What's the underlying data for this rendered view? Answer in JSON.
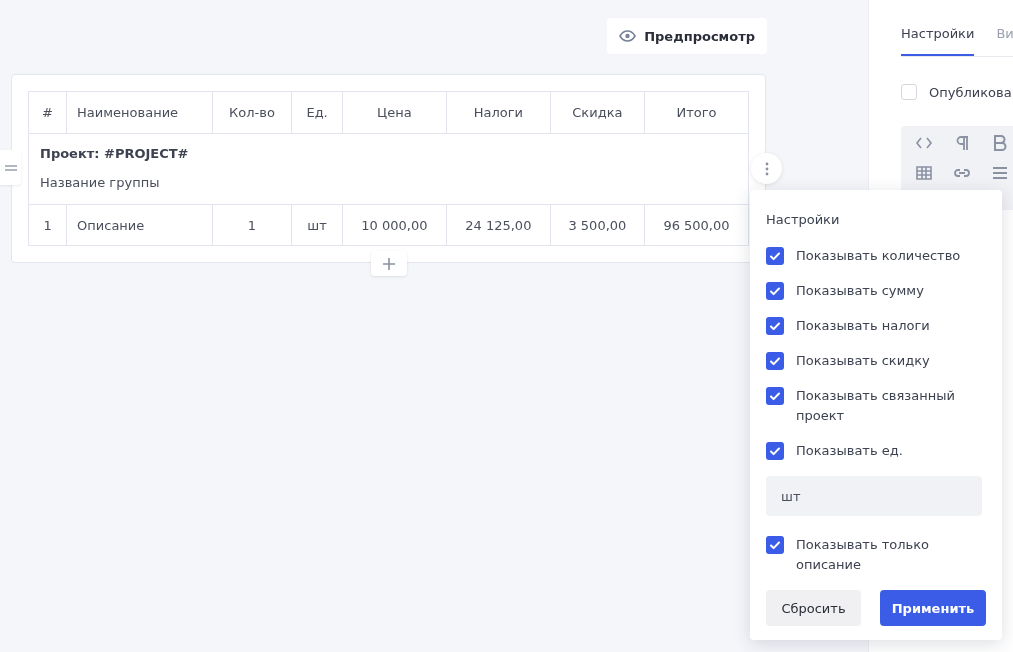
{
  "preview_button": {
    "label": "Предпросмотр"
  },
  "table": {
    "columns": [
      "#",
      "Наименование",
      "Кол-во",
      "Ед.",
      "Цена",
      "Налоги",
      "Скидка",
      "Итого"
    ],
    "group": {
      "project": "Проект: #PROJECT#",
      "name": "Название группы"
    },
    "rows": [
      [
        "1",
        "Описание",
        "1",
        "шт",
        "10 000,00",
        "24 125,00",
        "3 500,00",
        "96 500,00"
      ]
    ]
  },
  "settings_popup": {
    "title": "Настройки",
    "options": [
      {
        "label": "Показывать количество",
        "checked": true
      },
      {
        "label": "Показывать сумму",
        "checked": true
      },
      {
        "label": "Показывать налоги",
        "checked": true
      },
      {
        "label": "Показывать скидку",
        "checked": true
      },
      {
        "label": "Показывать связанный проект",
        "checked": true
      },
      {
        "label": "Показывать ед.",
        "checked": true
      },
      {
        "kind": "field",
        "value": "шт"
      },
      {
        "label": "Показывать только описание",
        "checked": true
      }
    ],
    "buttons": [
      {
        "label": "Сбросить",
        "kind": "secondary"
      },
      {
        "label": "Применить",
        "kind": "primary"
      }
    ]
  },
  "sidebar": {
    "tabs": [
      {
        "label": "Настройки",
        "selected": true
      },
      {
        "label": "Ви",
        "selected": false
      }
    ],
    "publish": {
      "label": "Опубликова",
      "checked": false
    }
  }
}
